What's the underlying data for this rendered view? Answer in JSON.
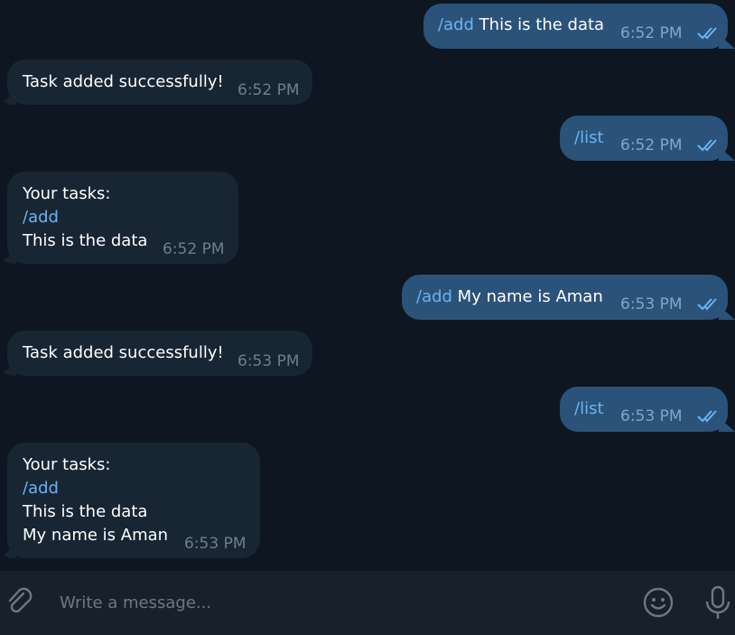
{
  "messages": [
    {
      "direction": "out",
      "command": "/add",
      "text": " This is the data",
      "time": "6:52 PM"
    },
    {
      "direction": "in",
      "text": "Task added successfully!",
      "time": "6:52 PM"
    },
    {
      "direction": "out",
      "command": "/list",
      "text": "",
      "time": "6:52 PM"
    },
    {
      "direction": "in",
      "lines": [
        "Your tasks:",
        "/add",
        "This is the data"
      ],
      "time": "6:52 PM"
    },
    {
      "direction": "out",
      "command": "/add",
      "text": " My name is Aman",
      "time": "6:53 PM"
    },
    {
      "direction": "in",
      "text": "Task added successfully!",
      "time": "6:53 PM"
    },
    {
      "direction": "out",
      "command": "/list",
      "text": "",
      "time": "6:53 PM"
    },
    {
      "direction": "in",
      "lines": [
        "Your tasks:",
        "/add",
        "This is the data",
        "My name is Aman"
      ],
      "time": "6:53 PM"
    }
  ],
  "composer": {
    "placeholder": "Write a message...",
    "value": ""
  },
  "icons": {
    "attach": "paperclip-icon",
    "emoji": "emoji-icon",
    "mic": "microphone-icon",
    "read": "double-check-icon"
  },
  "colors": {
    "background": "#0e1621",
    "incoming_bubble": "#182533",
    "outgoing_bubble": "#2b5278",
    "command_link": "#6ab3f3",
    "composer_bar": "#17212b"
  }
}
